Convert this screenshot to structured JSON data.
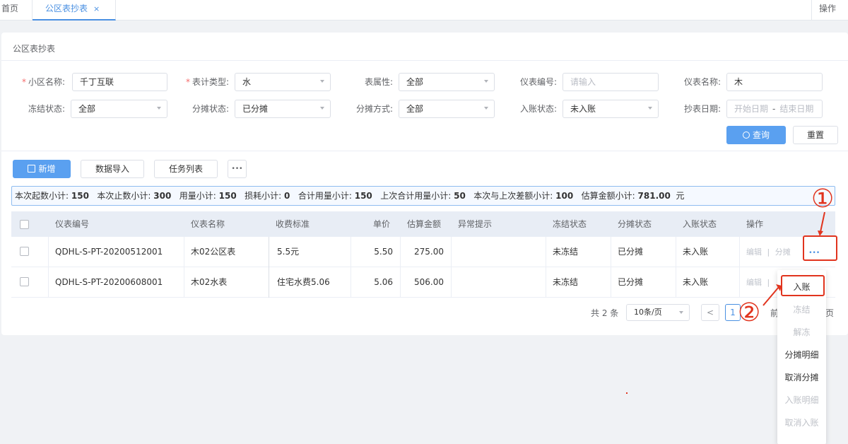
{
  "tabs": {
    "home": "首页",
    "active": "公区表抄表",
    "close": "×",
    "ops": "操作"
  },
  "panel_title": "公区表抄表",
  "filters": {
    "community": {
      "label": "小区名称:",
      "value": "千丁互联",
      "required": "*"
    },
    "meter_type": {
      "label": "表计类型:",
      "value": "水",
      "required": "*"
    },
    "attribute": {
      "label": "表属性:",
      "value": "全部"
    },
    "meter_no": {
      "label": "仪表编号:",
      "placeholder": "请输入"
    },
    "meter_name": {
      "label": "仪表名称:",
      "value": "木"
    },
    "freeze": {
      "label": "冻结状态:",
      "value": "全部"
    },
    "split_status": {
      "label": "分摊状态:",
      "value": "已分摊"
    },
    "split_method": {
      "label": "分摊方式:",
      "value": "全部"
    },
    "account_status": {
      "label": "入账状态:",
      "value": "未入账"
    },
    "read_date": {
      "label": "抄表日期:",
      "start": "开始日期",
      "sep": "-",
      "end": "结束日期"
    }
  },
  "buttons": {
    "query": "查询",
    "reset": "重置",
    "add": "新增",
    "import": "数据导入",
    "tasks": "任务列表",
    "more": "•••"
  },
  "summary": [
    {
      "label": "本次起数小计:",
      "value": "150"
    },
    {
      "label": "本次止数小计:",
      "value": "300"
    },
    {
      "label": "用量小计:",
      "value": "150"
    },
    {
      "label": "损耗小计:",
      "value": "0"
    },
    {
      "label": "合计用量小计:",
      "value": "150"
    },
    {
      "label": "上次合计用量小计:",
      "value": "50"
    },
    {
      "label": "本次与上次差额小计:",
      "value": "100"
    },
    {
      "label": "估算金额小计:",
      "value": "781.00",
      "unit": "元"
    }
  ],
  "table": {
    "headers": [
      "仪表编号",
      "仪表名称",
      "收费标准",
      "单价",
      "估算金额",
      "异常提示",
      "冻结状态",
      "分摊状态",
      "入账状态",
      "操作"
    ],
    "rows": [
      {
        "no": "QDHL-S-PT-20200512001",
        "name": "木02公区表",
        "standard": "5.5元",
        "price": "5.50",
        "amount": "275.00",
        "alert": "",
        "freeze": "未冻结",
        "split": "已分摊",
        "account": "未入账",
        "op_edit": "编辑",
        "op_sep": "|",
        "op_split": "分摊",
        "op_more": "•••"
      },
      {
        "no": "QDHL-S-PT-20200608001",
        "name": "木02水表",
        "standard": "住宅水费5.06",
        "price": "5.06",
        "amount": "506.00",
        "alert": "",
        "freeze": "未冻结",
        "split": "已分摊",
        "account": "未入账",
        "op_edit": "编辑",
        "op_sep": "|"
      }
    ]
  },
  "pagination": {
    "total": "共 2 条",
    "page_size": "10条/页",
    "prev": "<",
    "current": "1",
    "goto_partial": "前",
    "tail": "页"
  },
  "menu": [
    {
      "label": "入账",
      "enabled": true
    },
    {
      "label": "冻结",
      "enabled": false
    },
    {
      "label": "解冻",
      "enabled": false
    },
    {
      "label": "分摊明细",
      "enabled": true
    },
    {
      "label": "取消分摊",
      "enabled": true
    },
    {
      "label": "入账明细",
      "enabled": false
    },
    {
      "label": "取消入账",
      "enabled": false
    }
  ],
  "annotations": {
    "one": "①",
    "two": "②"
  },
  "colors": {
    "primary": "#5aa0f0",
    "annotation": "#e1341e"
  }
}
